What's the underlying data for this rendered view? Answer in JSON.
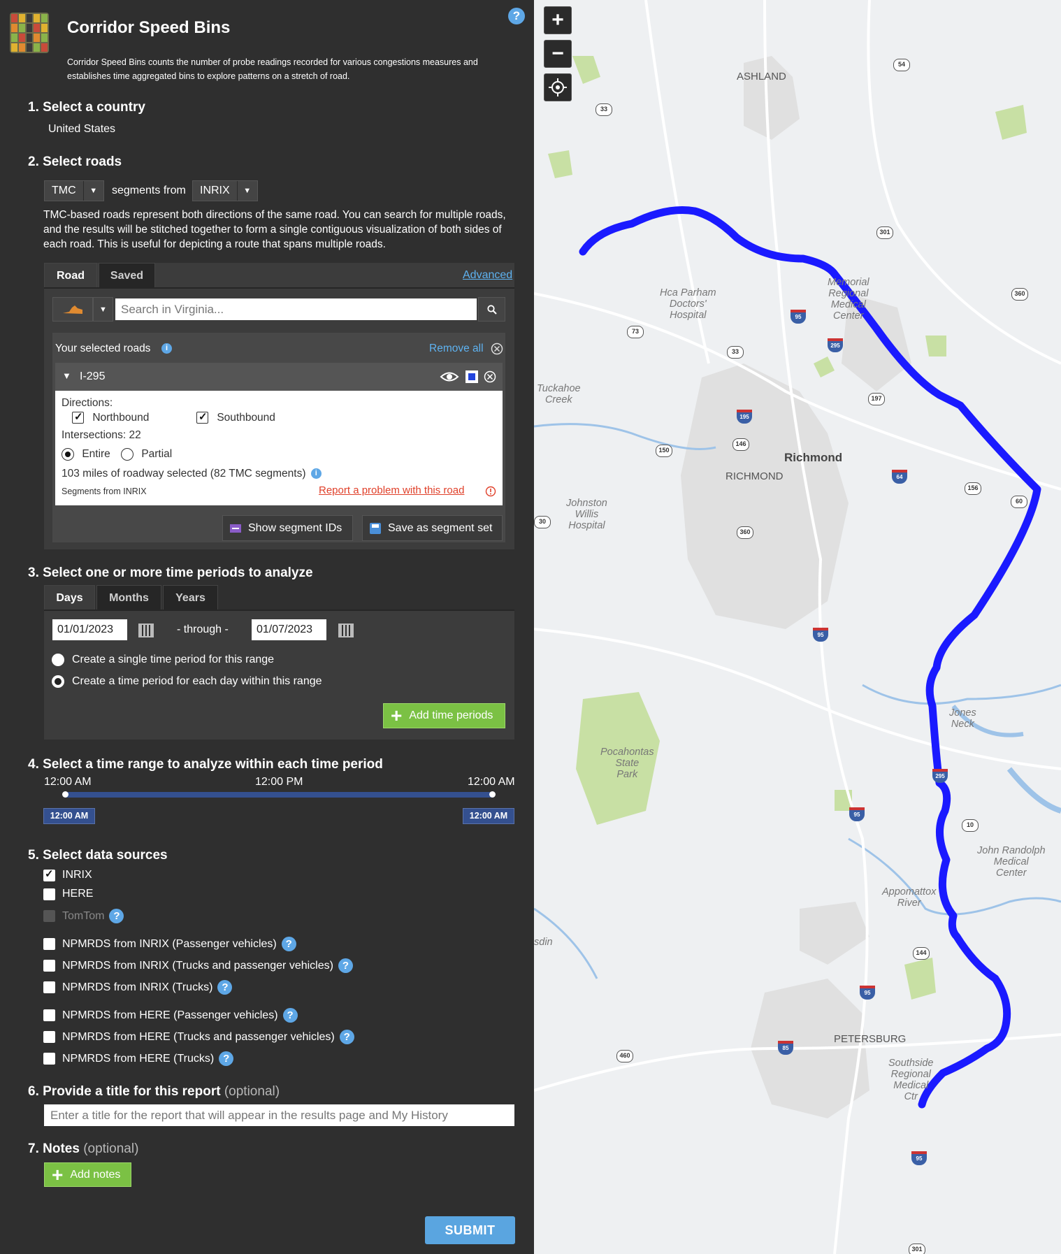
{
  "app": {
    "title": "Corridor Speed Bins",
    "description": "Corridor Speed Bins counts the number of probe readings recorded for various congestions measures and establishes time aggregated bins to explore patterns on a stretch of road.",
    "help": "?"
  },
  "step1": {
    "title": "1. Select a country",
    "country": "United States"
  },
  "step2": {
    "title": "2. Select roads",
    "segment_type": "TMC",
    "segments_from": "segments from",
    "provider": "INRIX",
    "help_text": "TMC-based roads represent both directions of the same road. You can search for multiple roads, and the results will be stitched together to form a single contiguous visualization of both sides of each road. This is useful for depicting a route that spans multiple roads.",
    "tabs": [
      "Road",
      "Saved"
    ],
    "advanced": "Advanced",
    "search_placeholder": "Search in Virginia...",
    "selected_label": "Your selected roads",
    "remove_all": "Remove all",
    "road": {
      "name": "I-295",
      "directions_label": "Directions:",
      "northbound": "Northbound",
      "southbound": "Southbound",
      "intersections": "Intersections: 22",
      "entire": "Entire",
      "partial": "Partial",
      "miles": "103 miles of roadway selected (82 TMC segments)",
      "source": "Segments from INRIX",
      "report": "Report a problem with this road"
    },
    "show_ids": "Show segment IDs",
    "save_set": "Save as segment set"
  },
  "step3": {
    "title": "3. Select one or more time periods to analyze",
    "tabs": [
      "Days",
      "Months",
      "Years"
    ],
    "start_date": "01/01/2023",
    "through": "- through -",
    "end_date": "01/07/2023",
    "opt_single": "Create a single time period for this range",
    "opt_each": "Create a time period for each day within this range",
    "add": "Add time periods"
  },
  "step4": {
    "title": "4. Select a time range to analyze within each time period",
    "tick_start": "12:00 AM",
    "tick_mid": "12:00 PM",
    "tick_end": "12:00 AM",
    "handle_start": "12:00 AM",
    "handle_end": "12:00 AM"
  },
  "step5": {
    "title": "5. Select data sources",
    "sources": [
      "INRIX",
      "HERE",
      "TomTom"
    ],
    "npm_inrix": [
      "NPMRDS from INRIX (Passenger vehicles)",
      "NPMRDS from INRIX (Trucks and passenger vehicles)",
      "NPMRDS from INRIX (Trucks)"
    ],
    "npm_here": [
      "NPMRDS from HERE (Passenger vehicles)",
      "NPMRDS from HERE (Trucks and passenger vehicles)",
      "NPMRDS from HERE (Trucks)"
    ]
  },
  "step6": {
    "title": "6. Provide a title for this report",
    "optional": "(optional)",
    "placeholder": "Enter a title for the report that will appear in the results page and My History"
  },
  "step7": {
    "title": "7. Notes",
    "optional": "(optional)",
    "add": "Add notes"
  },
  "submit": "SUBMIT",
  "map": {
    "labels": {
      "ashland": "ASHLAND",
      "richmond_city": "Richmond",
      "richmond": "RICHMOND",
      "petersburg": "PETERSBURG",
      "hca": "Hca Parham\nDoctors'\nHospital",
      "tuckahoe": "Tuckahoe\nCreek",
      "johnston": "Johnston\nWillis\nHospital",
      "pocahontas": "Pocahontas\nState\nPark",
      "memorial": "Memorial\nRegional\nMedical\nCenter",
      "jones": "Jones\nNeck",
      "john": "John Randolph\nMedical\nCenter",
      "appomattox": "Appomattox\nRiver",
      "southside": "Southside\nRegional\nMedical\nCtr",
      "sdin": "sdin"
    },
    "shields": [
      "54",
      "33",
      "301",
      "360",
      "73",
      "33",
      "197",
      "150",
      "146",
      "156",
      "60",
      "360",
      "10",
      "144",
      "460",
      "301",
      "30"
    ],
    "interstates": [
      "95",
      "295",
      "195",
      "64",
      "95",
      "295",
      "95",
      "95",
      "85",
      "95"
    ]
  },
  "colors": {
    "route": "#1a1aff",
    "accent": "#5aa5e0",
    "green": "#7bc144",
    "panel": "#2f2f2f"
  }
}
